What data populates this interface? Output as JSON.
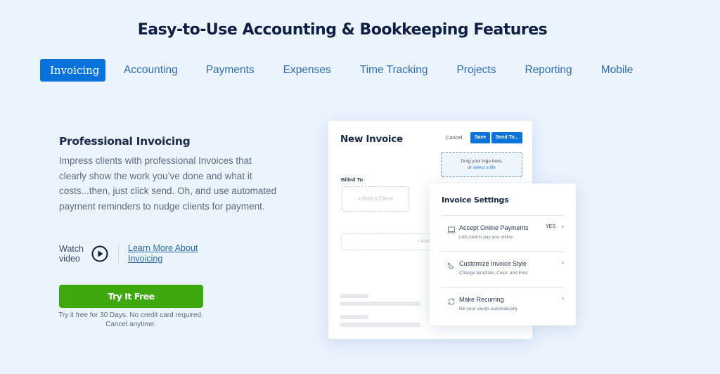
{
  "page": {
    "title": "Easy-to-Use Accounting & Bookkeeping Features"
  },
  "tabs": [
    {
      "label": "Invoicing",
      "active": true
    },
    {
      "label": "Accounting",
      "active": false
    },
    {
      "label": "Payments",
      "active": false
    },
    {
      "label": "Expenses",
      "active": false
    },
    {
      "label": "Time Tracking",
      "active": false
    },
    {
      "label": "Projects",
      "active": false
    },
    {
      "label": "Reporting",
      "active": false
    },
    {
      "label": "Mobile",
      "active": false
    }
  ],
  "feature": {
    "title": "Professional Invoicing",
    "description": "Impress clients with professional Invoices that clearly show the work you’ve done and what it costs...then, just click send. Oh, and use automated payment reminders to nudge clients for payment.",
    "watch_label": "Watch video",
    "learn_more": "Learn More About Invoicing",
    "cta_label": "Try It Free",
    "cta_note": "Try it free for 30 Days. No credit card required. Cancel anytime."
  },
  "colors": {
    "accent": "#0a73db",
    "cta": "#3ea80f",
    "background": "#ebf3fd"
  },
  "invoice_mock": {
    "title": "New Invoice",
    "cancel": "Cancel",
    "save": "Save",
    "send": "Send To...",
    "logo_drop_line1": "Drag your logo here,",
    "logo_drop_or": "or ",
    "logo_drop_link": "select a file",
    "billed_to": "Billed To",
    "add_client": "+ Add a Client",
    "add_item": "+ Add"
  },
  "settings": {
    "title": "Invoice Settings",
    "rows": [
      {
        "icon": "laptop-icon",
        "label": "Accept Online Payments",
        "sub": "Lets clients pay you online",
        "value": "YES"
      },
      {
        "icon": "brush-icon",
        "label": "Customize Invoice Style",
        "sub": "Change template, Color, and Font",
        "value": ""
      },
      {
        "icon": "refresh-icon",
        "label": "Make Recurring",
        "sub": "Bill your clients automatically",
        "value": ""
      }
    ]
  }
}
